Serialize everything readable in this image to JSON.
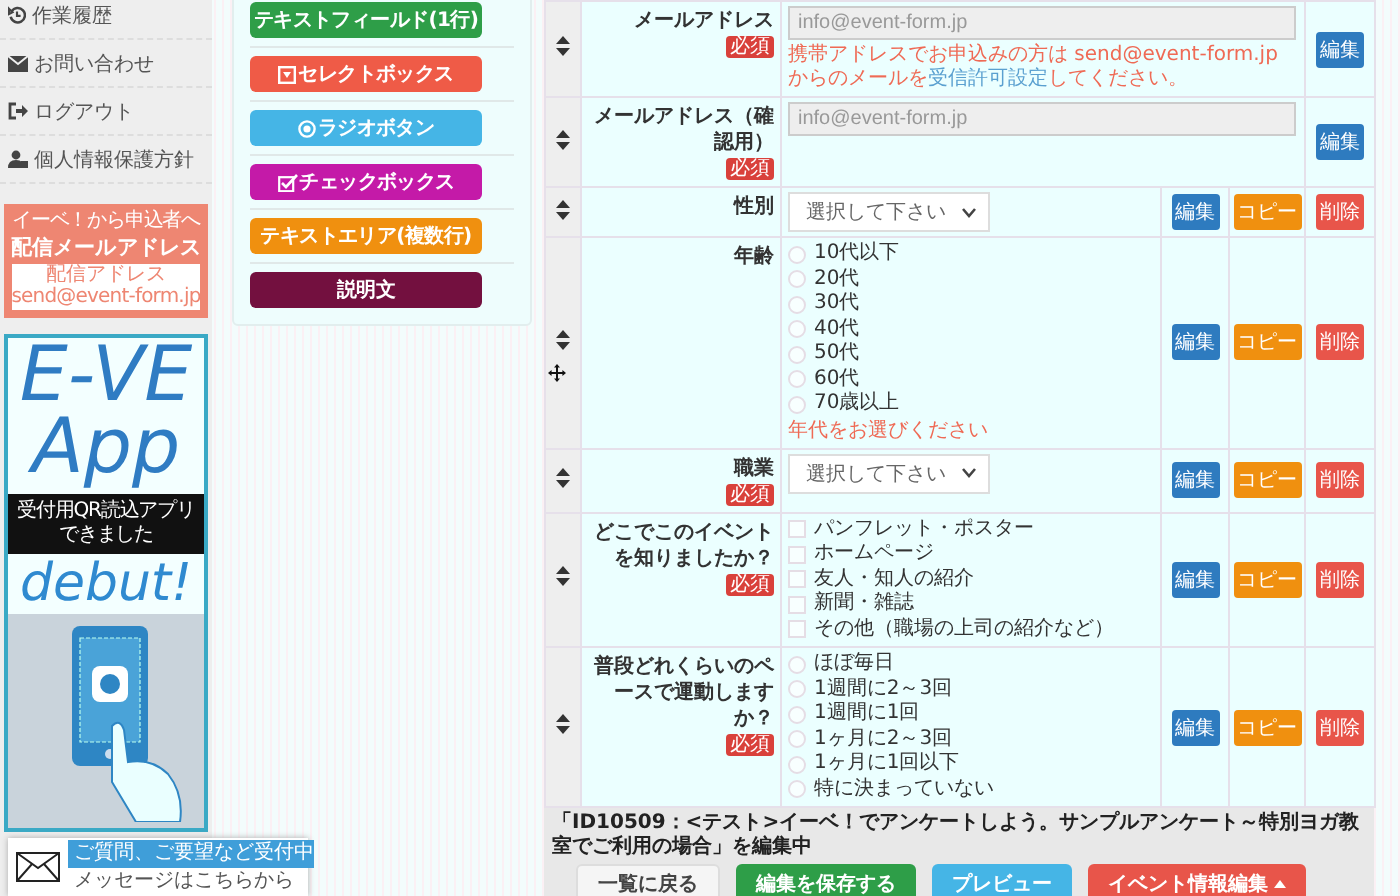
{
  "sidebar": {
    "nav": [
      {
        "label": "作業履歴"
      },
      {
        "label": "お問い合わせ"
      },
      {
        "label": "ログアウト"
      },
      {
        "label": "個人情報保護方針"
      }
    ],
    "mail_banner": {
      "heading": "イーベ！から申込者へ",
      "title": "配信メールアドレス",
      "address_label": "配信アドレス",
      "address": "send@event-form.jp"
    },
    "app_banner": {
      "title": [
        "E-VE",
        "App"
      ],
      "ribbon": [
        "受付用QR読込アプリ",
        "できました"
      ],
      "tagline": "debut!"
    }
  },
  "message_widget": {
    "title": "ご質問、ご要望など受付中",
    "subtitle": "メッセージはこちらから"
  },
  "palette": {
    "buttons": [
      {
        "label": "テキストフィールド(1行)",
        "kind": "text",
        "color": "#2e9e48"
      },
      {
        "label": "セレクトボックス",
        "kind": "select",
        "color": "#ef5b47"
      },
      {
        "label": "ラジオボタン",
        "kind": "radio",
        "color": "#45b5e6"
      },
      {
        "label": "チェックボックス",
        "kind": "checkbox",
        "color": "#c41aa8"
      },
      {
        "label": "テキストエリア(複数行)",
        "kind": "textarea",
        "color": "#f0900f"
      },
      {
        "label": "説明文",
        "kind": "description",
        "color": "#73103f"
      }
    ]
  },
  "form": {
    "rows": [
      {
        "label": "メールアドレス",
        "badge": "必須",
        "field": {
          "kind": "email",
          "placeholder": "info@event-form.jp",
          "note": {
            "before": "携帯アドレスでお申込みの方は send@event-form.jp からのメールを",
            "link": "受信許可設定",
            "after": "してください。"
          }
        },
        "actions": [
          {
            "label": "編集",
            "kind": "edit"
          }
        ]
      },
      {
        "label": "メールアドレス（確認用）",
        "badge": "必須",
        "field": {
          "kind": "email",
          "placeholder": "info@event-form.jp"
        },
        "actions": [
          {
            "label": "編集",
            "kind": "edit"
          }
        ]
      },
      {
        "label": "性別",
        "field": {
          "kind": "select",
          "value": "選択して下さい"
        },
        "actions": [
          {
            "label": "編集",
            "kind": "edit"
          },
          {
            "label": "コピー",
            "kind": "copy"
          },
          {
            "label": "削除",
            "kind": "delete"
          }
        ]
      },
      {
        "label": "年齢",
        "field": {
          "kind": "radio",
          "options": [
            {
              "label": "10代以下",
              "selected": false
            },
            {
              "label": "20代",
              "selected": false
            },
            {
              "label": "30代",
              "selected": false
            },
            {
              "label": "40代",
              "selected": false
            },
            {
              "label": "50代",
              "selected": false
            },
            {
              "label": "60代",
              "selected": false
            },
            {
              "label": "70歳以上",
              "selected": false
            }
          ],
          "error": "年代をお選びください"
        },
        "actions": [
          {
            "label": "編集",
            "kind": "edit"
          },
          {
            "label": "コピー",
            "kind": "copy"
          },
          {
            "label": "削除",
            "kind": "delete"
          }
        ]
      },
      {
        "label": "職業",
        "badge": "必須",
        "field": {
          "kind": "select",
          "value": "選択して下さい"
        },
        "actions": [
          {
            "label": "編集",
            "kind": "edit"
          },
          {
            "label": "コピー",
            "kind": "copy"
          },
          {
            "label": "削除",
            "kind": "delete"
          }
        ]
      },
      {
        "label": "どこでこのイベントを知りましたか？",
        "badge": "必須",
        "field": {
          "kind": "checkbox",
          "options": [
            {
              "label": "パンフレット・ポスター",
              "checked": false
            },
            {
              "label": "ホームページ",
              "checked": false
            },
            {
              "label": "友人・知人の紹介",
              "checked": false
            },
            {
              "label": "新聞・雑誌",
              "checked": false
            },
            {
              "label": "その他（職場の上司の紹介など）",
              "checked": false
            }
          ]
        },
        "actions": [
          {
            "label": "編集",
            "kind": "edit"
          },
          {
            "label": "コピー",
            "kind": "copy"
          },
          {
            "label": "削除",
            "kind": "delete"
          }
        ]
      },
      {
        "label": "普段どれくらいのペースで運動しますか？",
        "badge": "必須",
        "field": {
          "kind": "radio",
          "options": [
            {
              "label": "ほぼ毎日",
              "selected": false
            },
            {
              "label": "1週間に2～3回",
              "selected": false
            },
            {
              "label": "1週間に1回",
              "selected": false
            },
            {
              "label": "1ヶ月に2～3回",
              "selected": false
            },
            {
              "label": "1ヶ月に1回以下",
              "selected": false
            },
            {
              "label": "特に決まっていない",
              "selected": false
            }
          ]
        },
        "actions": [
          {
            "label": "編集",
            "kind": "edit"
          },
          {
            "label": "コピー",
            "kind": "copy"
          },
          {
            "label": "削除",
            "kind": "delete"
          }
        ]
      }
    ]
  },
  "footer": {
    "caption": "「ID10509：<テスト>イーベ！でアンケートしよう。サンプルアンケート～特別ヨガ教室でご利用の場合」を編集中",
    "buttons": [
      {
        "label": "一覧に戻る",
        "kind": "back"
      },
      {
        "label": "編集を保存する",
        "kind": "save"
      },
      {
        "label": "プレビュー",
        "kind": "preview"
      },
      {
        "label": "イベント情報編集",
        "kind": "menu"
      }
    ]
  }
}
